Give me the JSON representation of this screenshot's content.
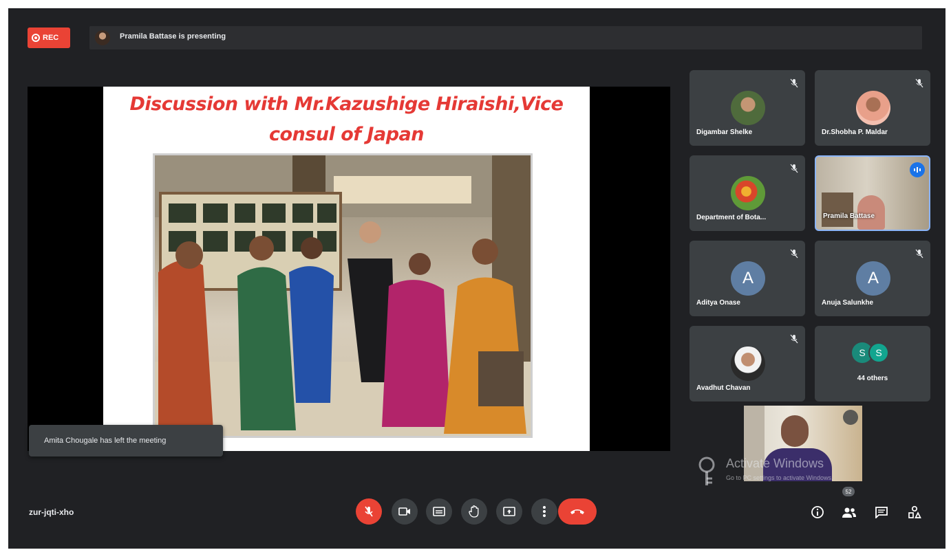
{
  "recording": {
    "label": "REC"
  },
  "presenting": {
    "text": "Pramila Battase is presenting"
  },
  "slide": {
    "title_line1": "Discussion with Mr.Kazushige Hiraishi,Vice",
    "title_line2": "consul of Japan"
  },
  "toast": {
    "text": "Amita Chougale has left the meeting"
  },
  "participants": [
    {
      "name": "Digambar Shelke",
      "avatar": "photo"
    },
    {
      "name": "Dr.Shobha P. Maldar",
      "avatar": "photo"
    },
    {
      "name": "Department of Bota...",
      "avatar": "flower-photo"
    },
    {
      "name": "Pramila Battase",
      "avatar": "video",
      "speaking": true
    },
    {
      "name": "Aditya Onase",
      "avatar_letter": "A"
    },
    {
      "name": "Anuja Salunkhe",
      "avatar_letter": "A"
    },
    {
      "name": "Avadhut Chavan",
      "avatar": "photo"
    },
    {
      "name": "44 others",
      "avatar_letters": [
        "S",
        "S"
      ]
    }
  ],
  "watermark": {
    "line1": "Activate Windows",
    "line2": "Go to PC settings to activate Windows."
  },
  "meeting": {
    "code": "zur-jqti-xho",
    "people_count": "52"
  },
  "colors": {
    "background": "#202124",
    "tile": "#3c4043",
    "danger": "#ea4335",
    "accent": "#1a73e8",
    "title_red": "#e53935"
  }
}
